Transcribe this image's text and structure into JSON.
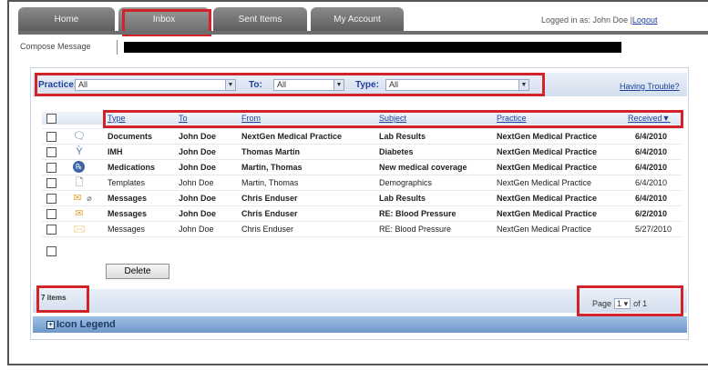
{
  "tabs": [
    {
      "label": "Home"
    },
    {
      "label": "Inbox"
    },
    {
      "label": "Sent Items"
    },
    {
      "label": "My Account"
    }
  ],
  "header": {
    "logged_in_text": "Logged in as: John Doe |",
    "logout_label": "Logout"
  },
  "compose": {
    "label": "Compose Message"
  },
  "filters": {
    "practice_label": "Practice:",
    "practice_value": "All",
    "to_label": "To:",
    "to_value": "All",
    "type_label": "Type:",
    "type_value": "All",
    "trouble_link": "Having Trouble?"
  },
  "table": {
    "headers": [
      "Type",
      "To",
      "From",
      "Subject",
      "Practice",
      "Received▼"
    ],
    "rows": [
      {
        "type": "Documents",
        "to": "John Doe",
        "from": "NextGen Medical Practice",
        "subject": "Lab Results",
        "practice": "NextGen Medical Practice",
        "received": "6/4/2010",
        "icon": "document-speech-icon"
      },
      {
        "type": "IMH",
        "to": "John Doe",
        "from": "Thomas Martin",
        "subject": "Diabetes",
        "practice": "NextGen Medical Practice",
        "received": "6/4/2010",
        "icon": "imh-icon"
      },
      {
        "type": "Medications",
        "to": "John Doe",
        "from": "Martin, Thomas",
        "subject": "New medical coverage",
        "practice": "NextGen Medical Practice",
        "received": "6/4/2010",
        "icon": "medication-icon"
      },
      {
        "type": "Templates",
        "to": "John Doe",
        "from": "Martin, Thomas",
        "subject": "Demographics",
        "practice": "NextGen Medical Practice",
        "received": "6/4/2010",
        "icon": "template-icon"
      },
      {
        "type": "Messages",
        "to": "John Doe",
        "from": "Chris Enduser",
        "subject": "Lab Results",
        "practice": "NextGen Medical Practice",
        "received": "6/4/2010",
        "icon": "envelope-attachment-icon"
      },
      {
        "type": "Messages",
        "to": "John Doe",
        "from": "Chris Enduser",
        "subject": "RE: Blood Pressure",
        "practice": "NextGen Medical Practice",
        "received": "6/2/2010",
        "icon": "envelope-icon"
      },
      {
        "type": "Messages",
        "to": "John Doe",
        "from": "Chris Enduser",
        "subject": "RE: Blood Pressure",
        "practice": "NextGen Medical Practice",
        "received": "5/27/2010",
        "icon": "envelope-open-icon"
      }
    ],
    "delete_label": "Delete"
  },
  "footer": {
    "item_count": "7 items",
    "page_label": "Page",
    "page_value": "1",
    "of_label": "of 1",
    "legend_label": "Icon Legend"
  },
  "colors": {
    "accent": "#d2232a",
    "link": "#1c3f9c",
    "tab": "#6e6e6e"
  }
}
